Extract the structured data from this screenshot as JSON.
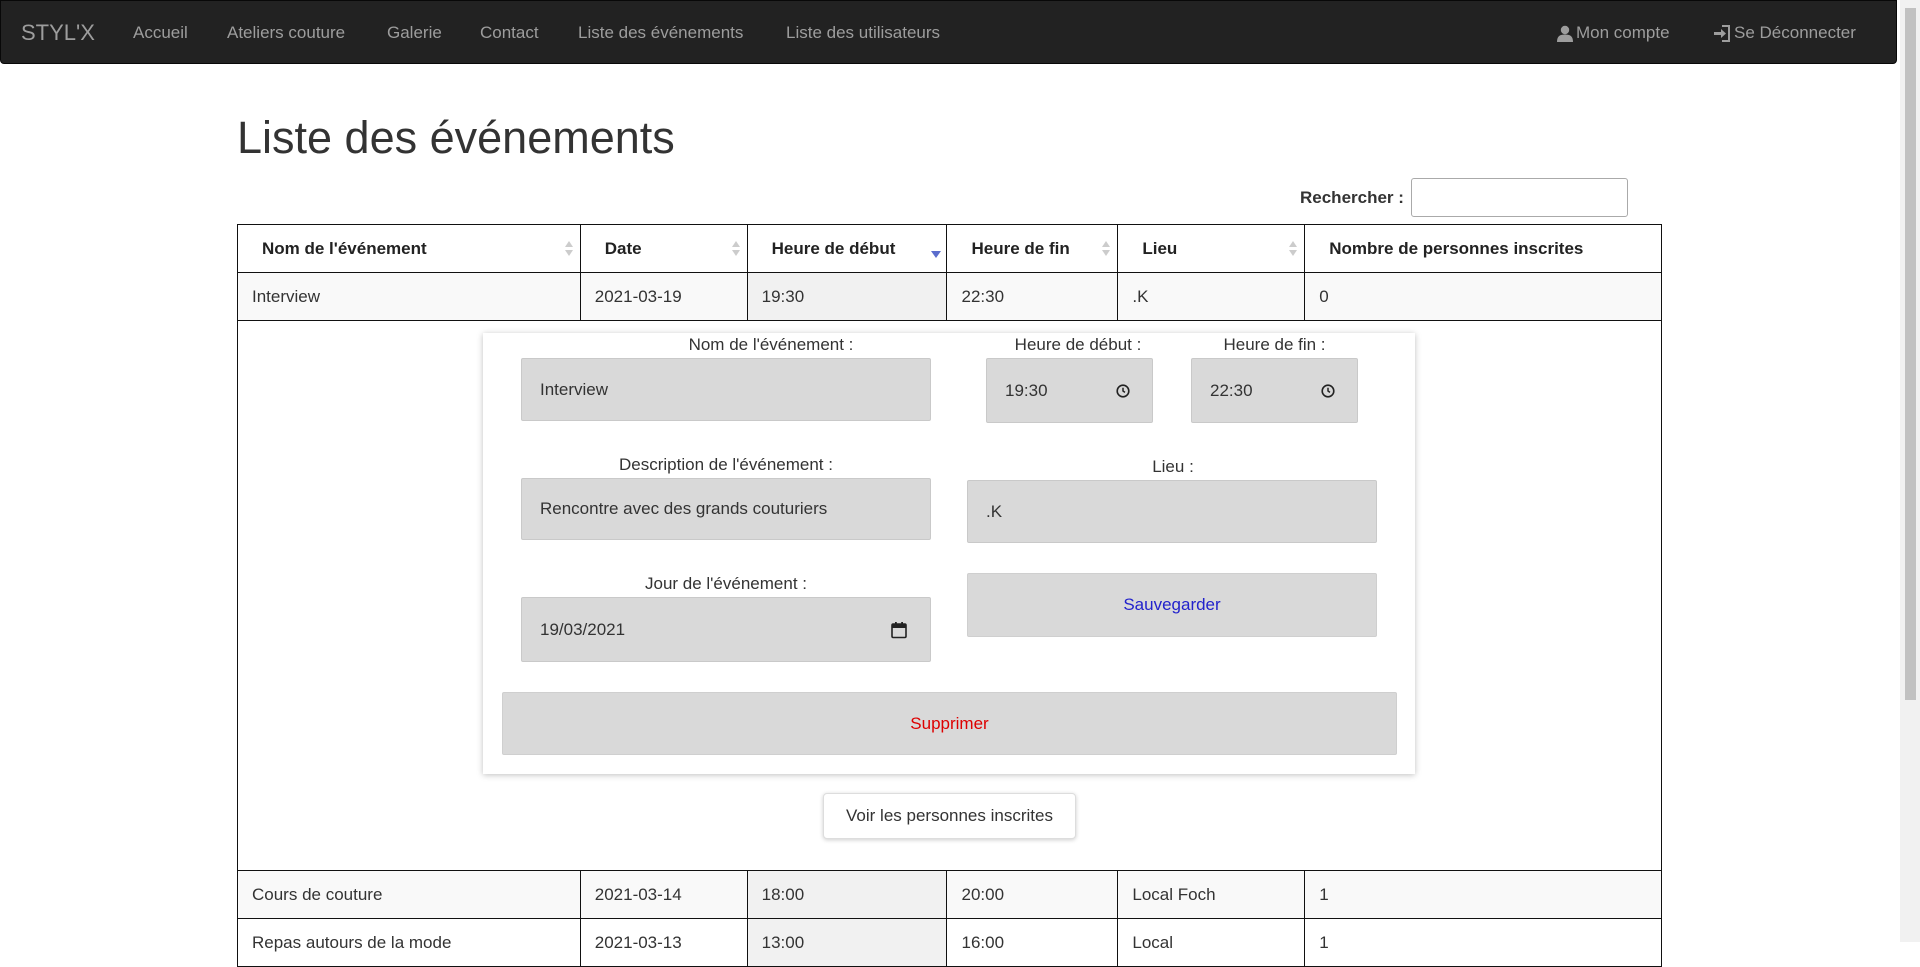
{
  "navbar": {
    "brand": "STYL'X",
    "links": [
      "Accueil",
      "Ateliers couture",
      "Galerie",
      "Contact",
      "Liste des événements",
      "Liste des utilisateurs"
    ],
    "account": {
      "label": "Mon compte",
      "icon": "user-icon"
    },
    "logout": {
      "label": "Se Déconnecter",
      "icon": "log-in-icon"
    }
  },
  "page": {
    "title": "Liste des événements"
  },
  "search": {
    "label": "Rechercher :",
    "value": ""
  },
  "table": {
    "headers": [
      "Nom de l'événement",
      "Date",
      "Heure de début",
      "Heure de fin",
      "Lieu",
      "Nombre de personnes inscrites"
    ],
    "sorted_column": "Heure de début",
    "sort_direction": "descending",
    "rows": [
      [
        "Interview",
        "2021-03-19",
        "19:30",
        "22:30",
        ".K",
        "0"
      ],
      [
        "Cours de couture",
        "2021-03-14",
        "18:00",
        "20:00",
        "Local Foch",
        "1"
      ],
      [
        "Repas autours de la mode",
        "2021-03-13",
        "13:00",
        "16:00",
        "Local",
        "1"
      ]
    ]
  },
  "edit_form": {
    "name_label": "Nom de l'événement :",
    "name_value": "Interview",
    "start_label": "Heure de début :",
    "start_value": "19:30",
    "end_label": "Heure de fin :",
    "end_value": "22:30",
    "description_label": "Description de l'événement :",
    "description_value": "Rencontre avec des grands couturiers",
    "place_label": "Lieu :",
    "place_value": ".K",
    "day_label": "Jour de l'événement :",
    "day_value": "19/03/2021",
    "save_label": "Sauvegarder",
    "delete_label": "Supprimer",
    "save_color": "#2222cc",
    "delete_color": "#dd0000"
  },
  "view_registered_label": "Voir les personnes inscrites",
  "colors": {
    "navbar_bg": "#222222",
    "nav_text": "#9d9d9d",
    "field_bg": "#d9d9d9",
    "sort_active": "#5b6dcd"
  }
}
